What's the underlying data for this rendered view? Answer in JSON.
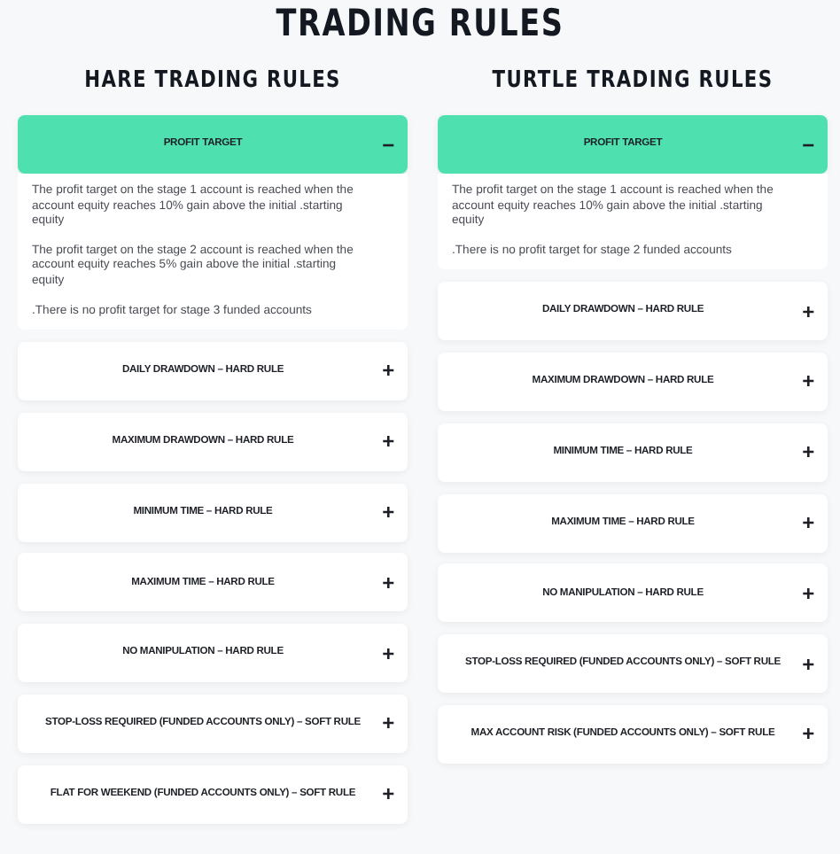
{
  "title": "TRADING RULES",
  "columns": [
    {
      "title": "HARE TRADING RULES",
      "sections": [
        {
          "label": "PROFIT TARGET",
          "expanded": true,
          "toggle": "−",
          "paragraphs": [
            "The profit target on the stage 1 account is reached when the account equity reaches 10% gain above the initial .starting equity",
            "The profit target on the stage 2 account is reached when the account equity reaches 5% gain above the initial .starting equity",
            ".There is no profit target for stage 3 funded accounts"
          ]
        },
        {
          "label": "DAILY DRAWDOWN – HARD RULE",
          "expanded": false,
          "toggle": "+"
        },
        {
          "label": "MAXIMUM DRAWDOWN – HARD RULE",
          "expanded": false,
          "toggle": "+"
        },
        {
          "label": "MINIMUM TIME – HARD RULE",
          "expanded": false,
          "toggle": "+"
        },
        {
          "label": "MAXIMUM TIME – HARD RULE",
          "expanded": false,
          "toggle": "+"
        },
        {
          "label": "NO MANIPULATION – HARD RULE",
          "expanded": false,
          "toggle": "+"
        },
        {
          "label": "STOP-LOSS REQUIRED (FUNDED ACCOUNTS ONLY) – SOFT RULE",
          "expanded": false,
          "toggle": "+"
        },
        {
          "label": "FLAT FOR WEEKEND (FUNDED ACCOUNTS ONLY) – SOFT RULE",
          "expanded": false,
          "toggle": "+"
        }
      ]
    },
    {
      "title": "TURTLE TRADING RULES",
      "sections": [
        {
          "label": "PROFIT TARGET",
          "expanded": true,
          "toggle": "−",
          "paragraphs": [
            "The profit target on the stage 1 account is reached when the account equity reaches 10% gain above the initial .starting equity",
            ".There is no profit target for stage 2 funded accounts"
          ]
        },
        {
          "label": "DAILY DRAWDOWN – HARD RULE",
          "expanded": false,
          "toggle": "+"
        },
        {
          "label": "MAXIMUM DRAWDOWN – HARD RULE",
          "expanded": false,
          "toggle": "+"
        },
        {
          "label": "MINIMUM TIME – HARD RULE",
          "expanded": false,
          "toggle": "+"
        },
        {
          "label": "MAXIMUM TIME – HARD RULE",
          "expanded": false,
          "toggle": "+"
        },
        {
          "label": "NO MANIPULATION – HARD RULE",
          "expanded": false,
          "toggle": "+"
        },
        {
          "label": "STOP-LOSS REQUIRED (FUNDED ACCOUNTS ONLY) – SOFT RULE",
          "expanded": false,
          "toggle": "+"
        },
        {
          "label": "MAX ACCOUNT RISK (FUNDED ACCOUNTS ONLY) – SOFT RULE",
          "expanded": false,
          "toggle": "+"
        }
      ]
    }
  ]
}
